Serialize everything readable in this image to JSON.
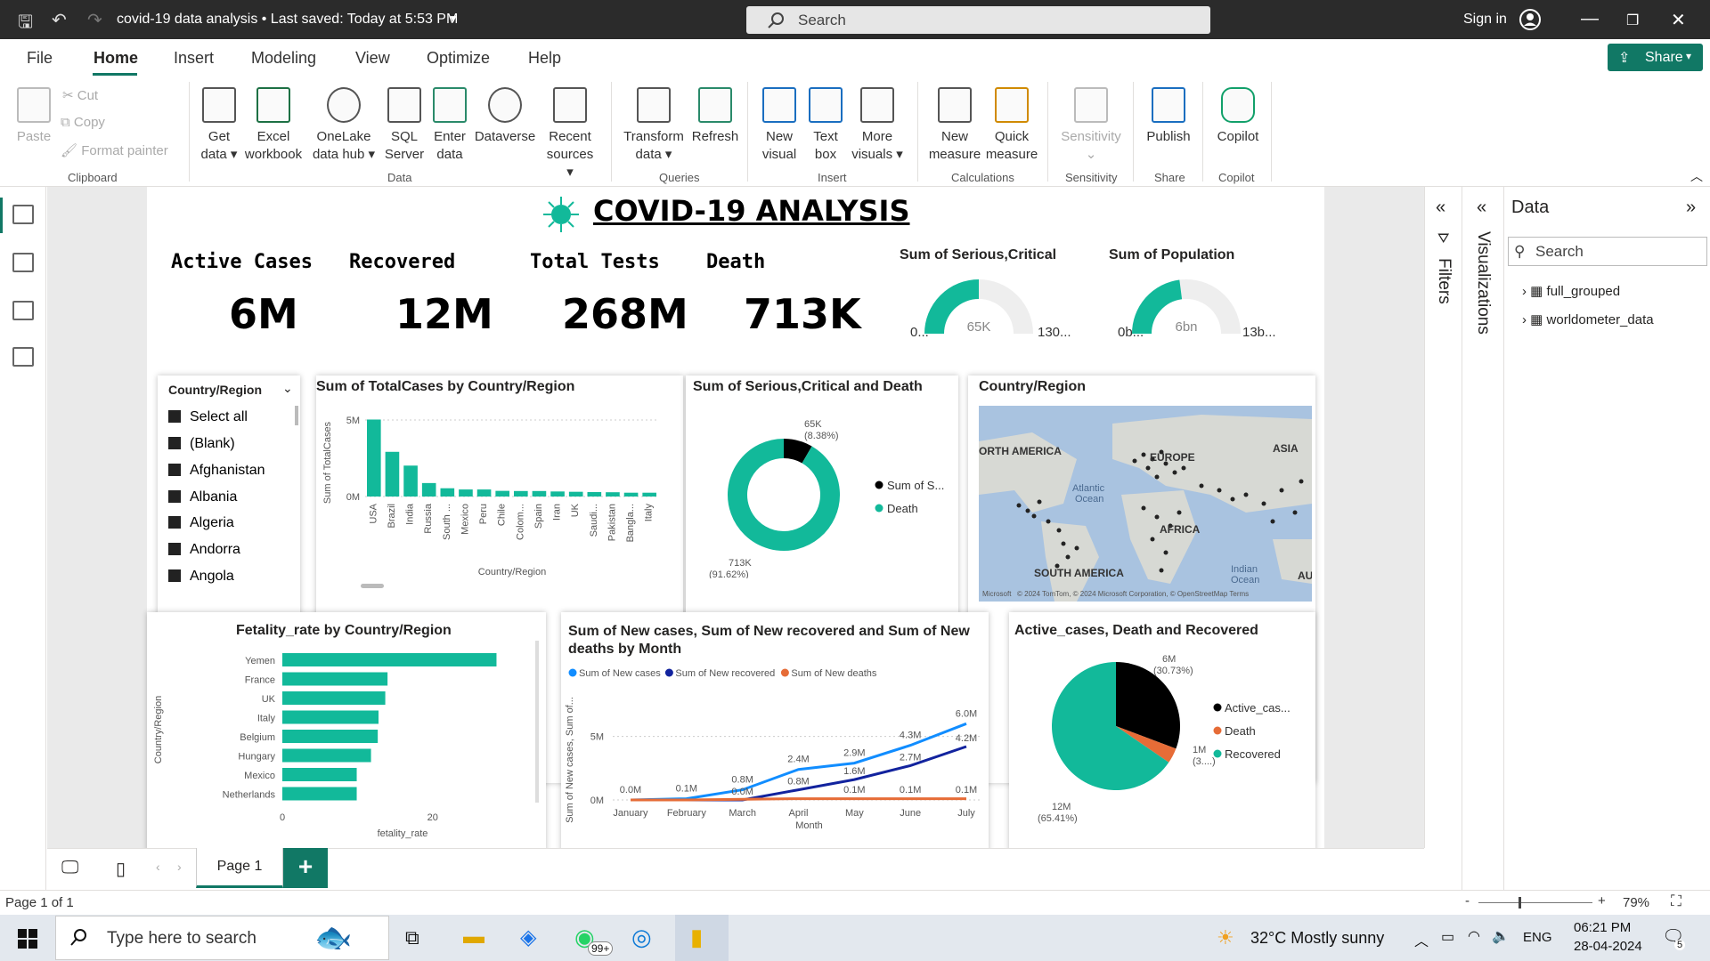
{
  "titlebar": {
    "title": "covid-19 data analysis  •  Last saved: Today at 5:53 PM",
    "search_placeholder": "Search",
    "signin": "Sign in"
  },
  "menu": {
    "items": [
      "File",
      "Home",
      "Insert",
      "Modeling",
      "View",
      "Optimize",
      "Help"
    ],
    "share": "Share"
  },
  "ribbon": {
    "clipboard": {
      "paste": "Paste",
      "cut": "Cut",
      "copy": "Copy",
      "format_painter": "Format painter",
      "group": "Clipboard"
    },
    "data": {
      "get_data": [
        "Get",
        "data"
      ],
      "excel": [
        "Excel",
        "workbook"
      ],
      "onelake": [
        "OneLake",
        "data hub"
      ],
      "sql": [
        "SQL",
        "Server"
      ],
      "enter": [
        "Enter",
        "data"
      ],
      "dataverse": "Dataverse",
      "recent": [
        "Recent",
        "sources"
      ],
      "group": "Data"
    },
    "queries": {
      "transform": [
        "Transform",
        "data"
      ],
      "refresh": "Refresh",
      "group": "Queries"
    },
    "insert": {
      "new_visual": [
        "New",
        "visual"
      ],
      "text_box": [
        "Text",
        "box"
      ],
      "more_visuals": [
        "More",
        "visuals"
      ],
      "group": "Insert"
    },
    "calculations": {
      "new_measure": [
        "New",
        "measure"
      ],
      "quick_measure": [
        "Quick",
        "measure"
      ],
      "group": "Calculations"
    },
    "sensitivity": {
      "label": "Sensitivity",
      "group": "Sensitivity"
    },
    "share": {
      "publish": "Publish",
      "group": "Share"
    },
    "copilot": {
      "label": "Copilot",
      "group": "Copilot"
    }
  },
  "report": {
    "title": "COVID-19 ANALYSIS",
    "kpis": [
      {
        "label": "Active Cases",
        "value": "6M"
      },
      {
        "label": "Recovered",
        "value": "12M"
      },
      {
        "label": "Total Tests",
        "value": "268M"
      },
      {
        "label": "Death",
        "value": "713K"
      }
    ],
    "gauges": [
      {
        "title": "Sum of Serious,Critical",
        "min": "0...",
        "value": "65K",
        "max": "130...",
        "fill": 0.5
      },
      {
        "title": "Sum of Population",
        "min": "0b...",
        "value": "6bn",
        "max": "13b...",
        "fill": 0.46
      }
    ],
    "slicer": {
      "title": "Country/Region",
      "items": [
        "Select all",
        "(Blank)",
        "Afghanistan",
        "Albania",
        "Algeria",
        "Andorra",
        "Angola"
      ]
    },
    "map": {
      "title": "Country/Region",
      "labels": [
        "ORTH AMERICA",
        "EUROPE",
        "ASIA",
        "Atlantic",
        "Ocean",
        "AFRICA",
        "SOUTH AMERICA",
        "Indian",
        "Ocean",
        "AU"
      ],
      "credit": "© 2024 TomTom, © 2024 Microsoft Corporation, © OpenStreetMap  Terms",
      "brand": "Microsoft"
    }
  },
  "chart_data": [
    {
      "type": "bar",
      "title": "Sum of TotalCases by Country/Region",
      "xlabel": "Country/Region",
      "ylabel": "Sum of TotalCases",
      "ylim": [
        0,
        5000000
      ],
      "yticks": [
        "0M",
        "5M"
      ],
      "categories": [
        "USA",
        "Brazil",
        "India",
        "Russia",
        "South ...",
        "Mexico",
        "Peru",
        "Chile",
        "Colom...",
        "Spain",
        "Iran",
        "UK",
        "Saudi...",
        "Pakistan",
        "Bangla...",
        "Italy"
      ],
      "values": [
        5030000,
        2920000,
        2020000,
        880000,
        540000,
        460000,
        460000,
        370000,
        360000,
        360000,
        330000,
        310000,
        290000,
        280000,
        250000,
        250000
      ]
    },
    {
      "type": "pie",
      "title": "Sum of Serious,Critical and Death",
      "donut": true,
      "series": [
        {
          "name": "Sum of S...",
          "label": "65K",
          "pct": "(8.38%)",
          "value": 65000,
          "color": "#000000"
        },
        {
          "name": "Death",
          "label": "713K",
          "pct": "(91.62%)",
          "value": 713000,
          "color": "#12b99a"
        }
      ]
    },
    {
      "type": "bar",
      "orientation": "horizontal",
      "title": "Fetality_rate by Country/Region",
      "xlabel": "fetality_rate",
      "ylabel": "Country/Region",
      "xticks": [
        "0",
        "20"
      ],
      "xlim": [
        0,
        32
      ],
      "categories": [
        "Yemen",
        "France",
        "UK",
        "Italy",
        "Belgium",
        "Hungary",
        "Mexico",
        "Netherlands"
      ],
      "values": [
        28.5,
        14.0,
        13.7,
        12.8,
        12.7,
        11.8,
        9.9,
        9.9
      ]
    },
    {
      "type": "line",
      "title": "Sum of New cases, Sum of New recovered and Sum of New deaths by Month",
      "xlabel": "Month",
      "ylabel": "Sum of New cases, Sum of...",
      "ylim": [
        0,
        7000000
      ],
      "yticks": [
        "0M",
        "5M"
      ],
      "x": [
        "January",
        "February",
        "March",
        "April",
        "May",
        "June",
        "July"
      ],
      "series": [
        {
          "name": "Sum of New cases",
          "color": "#118dff",
          "values": [
            0,
            0.1,
            0.8,
            2.4,
            2.9,
            4.3,
            6.0
          ],
          "labels": [
            "0.0M",
            "0.1M",
            "0.8M",
            "2.4M",
            "2.9M",
            "4.3M",
            "6.0M"
          ]
        },
        {
          "name": "Sum of New recovered",
          "color": "#12239e",
          "values": [
            0,
            0,
            0.0,
            0.8,
            1.6,
            2.7,
            4.2
          ],
          "labels": [
            "",
            "",
            "0.0M",
            "0.8M",
            "1.6M",
            "2.7M",
            "4.2M"
          ]
        },
        {
          "name": "Sum of New deaths",
          "color": "#e66c37",
          "values": [
            0,
            0,
            0.05,
            0.1,
            0.1,
            0.1,
            0.1
          ],
          "labels": [
            "",
            "",
            "",
            "",
            "0.1M",
            "0.1M",
            "0.1M"
          ]
        }
      ]
    },
    {
      "type": "pie",
      "title": "Active_cases, Death and Recovered",
      "series": [
        {
          "name": "Active_cas...",
          "label": "6M",
          "pct": "(30.73%)",
          "value": 30.73,
          "color": "#000000"
        },
        {
          "name": "Death",
          "label": "1M",
          "pct": "(3....)",
          "value": 3.86,
          "color": "#e66c37"
        },
        {
          "name": "Recovered",
          "label": "12M",
          "pct": "(65.41%)",
          "value": 65.41,
          "color": "#12b99a"
        }
      ]
    }
  ],
  "panes": {
    "filters": "Filters",
    "visualizations": "Visualizations",
    "data_title": "Data",
    "data_search": "Search",
    "tables": [
      "full_grouped",
      "worldometer_data"
    ]
  },
  "pages": {
    "tab": "Page 1",
    "status": "Page 1 of 1",
    "zoom": "79%"
  },
  "taskbar": {
    "search": "Type here to search",
    "weather": "32°C  Mostly sunny",
    "lang": "ENG",
    "time": "06:21 PM",
    "date": "28-04-2024",
    "badge": "99+",
    "notif": "5"
  }
}
